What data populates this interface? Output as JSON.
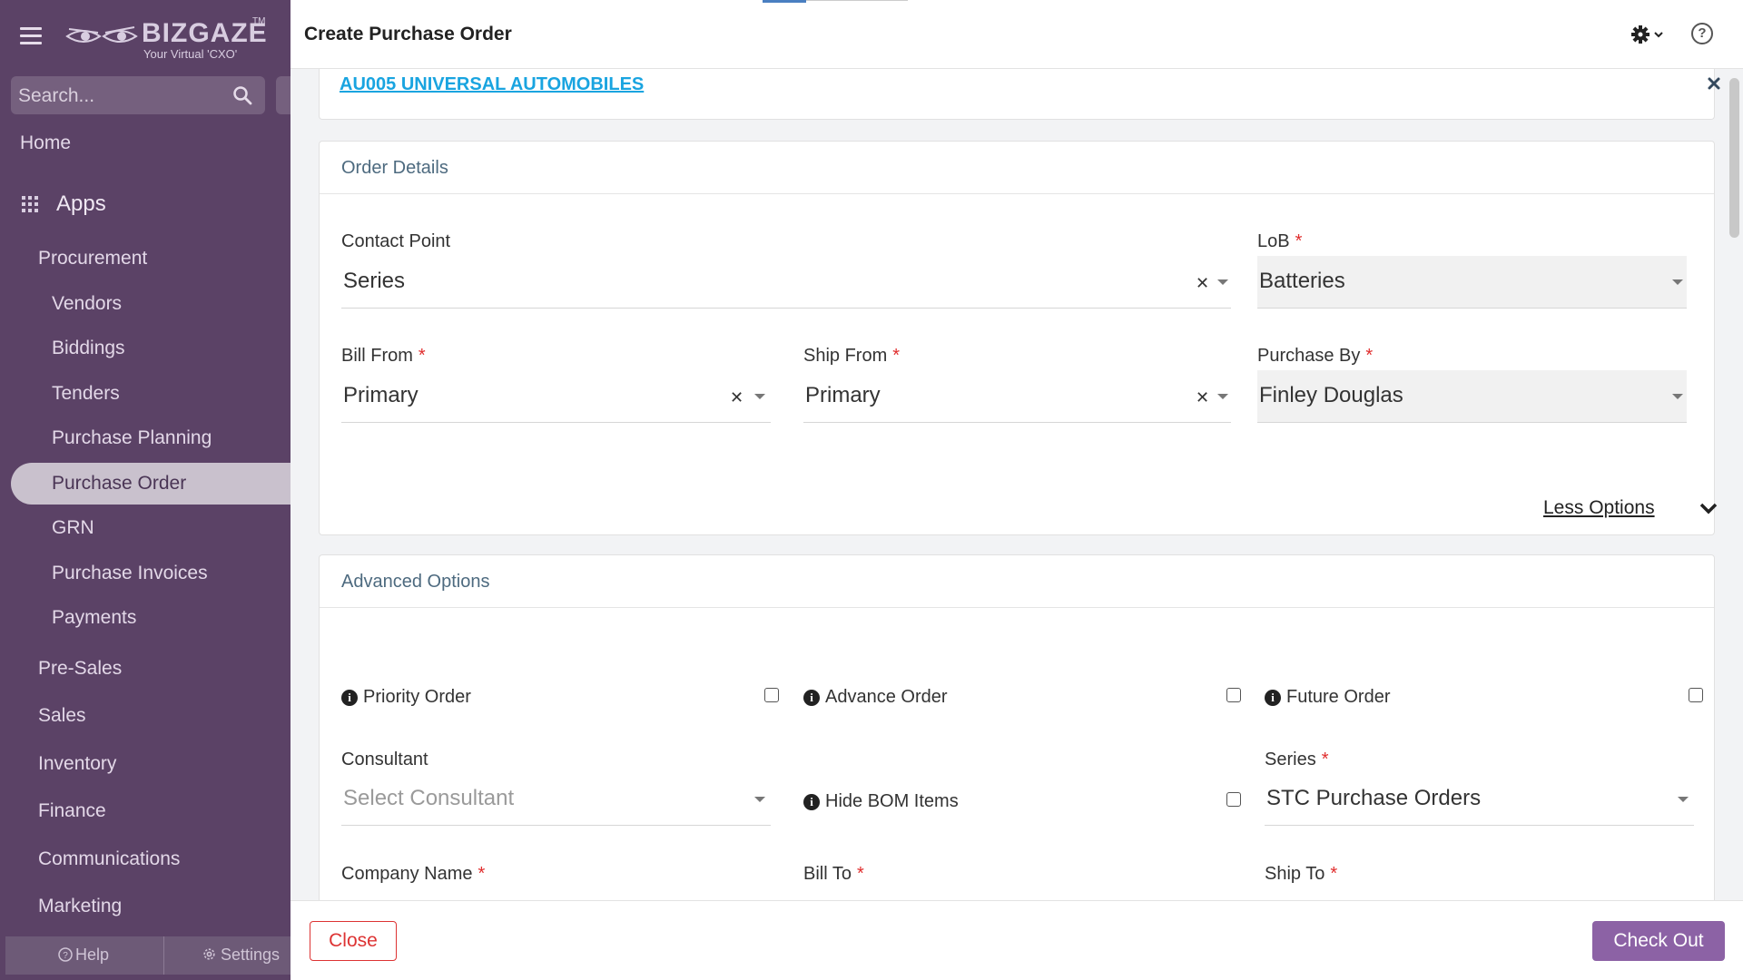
{
  "sidebar": {
    "logo": {
      "brand": "BIZGAZE",
      "tagline": "Your Virtual 'CXO'",
      "tm": "TM"
    },
    "search_placeholder": "Search...",
    "home": "Home",
    "apps": "Apps",
    "procurement": "Procurement",
    "procurement_items": [
      "Vendors",
      "Biddings",
      "Tenders",
      "Purchase Planning",
      "Purchase Order",
      "GRN",
      "Purchase Invoices",
      "Payments"
    ],
    "active_item": "Purchase Order",
    "sections": [
      "Pre-Sales",
      "Sales",
      "Inventory",
      "Finance",
      "Communications",
      "Marketing"
    ],
    "help": "Help",
    "settings": "Settings"
  },
  "header": {
    "title": "Create Purchase Order"
  },
  "vendor": {
    "link": "AU005 UNIVERSAL AUTOMOBILES"
  },
  "order_details": {
    "heading": "Order Details",
    "contact_point": {
      "label": "Contact Point",
      "value": "Series"
    },
    "lob": {
      "label": "LoB",
      "value": "Batteries",
      "required": "*"
    },
    "bill_from": {
      "label": "Bill From",
      "value": "Primary",
      "required": "*"
    },
    "ship_from": {
      "label": "Ship From",
      "value": "Primary",
      "required": "*"
    },
    "purchase_by": {
      "label": "Purchase By",
      "value": "Finley Douglas",
      "required": "*"
    },
    "less_options": "Less Options"
  },
  "advanced_options": {
    "heading": "Advanced Options",
    "priority_order": "Priority Order",
    "advance_order": "Advance Order",
    "future_order": "Future Order",
    "consultant": {
      "label": "Consultant",
      "placeholder": "Select Consultant"
    },
    "hide_bom_items": "Hide BOM Items",
    "series": {
      "label": "Series",
      "value": "STC Purchase Orders",
      "required": "*"
    },
    "company_name": {
      "label": "Company Name",
      "required": "*"
    },
    "bill_to": {
      "label": "Bill To",
      "required": "*"
    },
    "ship_to": {
      "label": "Ship To",
      "required": "*"
    }
  },
  "footer": {
    "close": "Close",
    "checkout": "Check Out"
  },
  "colors": {
    "sidebar": "#5b4266",
    "accent": "#8c62a5",
    "link": "#19a4e0",
    "required": "#e02d2d",
    "close": "#dd3333"
  }
}
